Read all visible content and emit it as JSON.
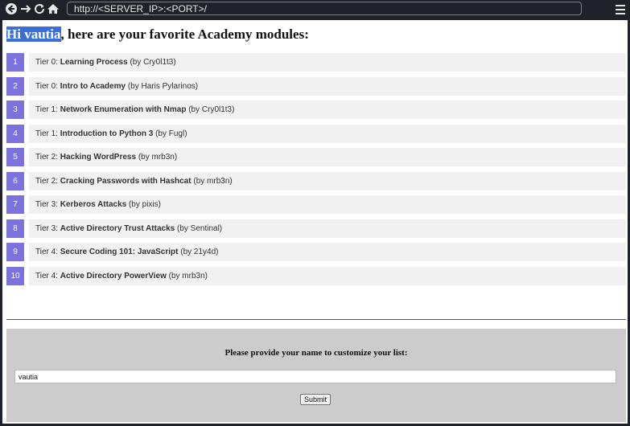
{
  "browser": {
    "url": "http://<SERVER_IP>:<PORT>/",
    "back_icon": "back-arrow",
    "forward_icon": "forward-arrow",
    "reload_icon": "reload",
    "home_icon": "home",
    "menu_icon": "hamburger-menu"
  },
  "page": {
    "greeting_name": "Hi vautia",
    "greeting_rest": ", here are your favorite Academy modules:",
    "highlight_color": "#3a6fd8",
    "number_badge_color": "#7b72dd"
  },
  "modules": [
    {
      "num": "1",
      "tier": "Tier 0: ",
      "title": "Learning Process",
      "author": " (by Cry0l1t3)"
    },
    {
      "num": "2",
      "tier": "Tier 0: ",
      "title": "Intro to Academy",
      "author": " (by Haris Pylarinos)"
    },
    {
      "num": "3",
      "tier": "Tier 1: ",
      "title": "Network Enumeration with Nmap",
      "author": " (by Cry0l1t3)"
    },
    {
      "num": "4",
      "tier": "Tier 1: ",
      "title": "Introduction to Python 3",
      "author": " (by Fugl)"
    },
    {
      "num": "5",
      "tier": "Tier 2: ",
      "title": "Hacking WordPress",
      "author": " (by mrb3n)"
    },
    {
      "num": "6",
      "tier": "Tier 2: ",
      "title": "Cracking Passwords with Hashcat",
      "author": " (by mrb3n)"
    },
    {
      "num": "7",
      "tier": "Tier 3: ",
      "title": "Kerberos Attacks",
      "author": " (by pixis)"
    },
    {
      "num": "8",
      "tier": "Tier 3: ",
      "title": "Active Directory Trust Attacks",
      "author": " (by Sentinal)"
    },
    {
      "num": "9",
      "tier": "Tier 4: ",
      "title": "Secure Coding 101: JavaScript",
      "author": " (by 21y4d)"
    },
    {
      "num": "10",
      "tier": "Tier 4: ",
      "title": "Active Directory PowerView",
      "author": " (by mrb3n)"
    }
  ],
  "form": {
    "prompt": "Please provide your name to customize your list:",
    "name_value": "vautia",
    "submit_label": "Submit"
  }
}
